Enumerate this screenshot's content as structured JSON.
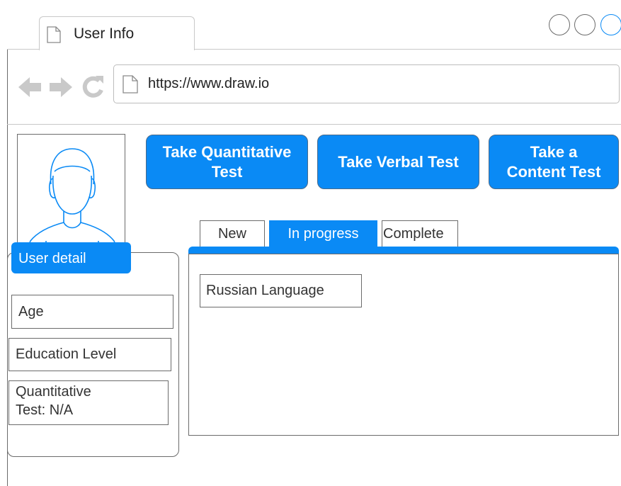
{
  "browser": {
    "tab_title": "User Info",
    "url": "https://www.draw.io",
    "icons": {
      "back": "back-arrow-icon",
      "forward": "forward-arrow-icon",
      "reload": "reload-icon",
      "page": "page-icon"
    }
  },
  "actions": [
    {
      "label": "Take Quantitative\nTest"
    },
    {
      "label": "Take Verbal Test"
    },
    {
      "label": "Take a\nContent Test"
    }
  ],
  "user_detail": {
    "header": "User detail",
    "fields": [
      {
        "value": "Age"
      },
      {
        "value": "Education Level"
      },
      {
        "value": "Quantitative\nTest: N/A"
      }
    ]
  },
  "status_tabs": [
    {
      "label": "New",
      "active": false
    },
    {
      "label": "In progress",
      "active": true
    },
    {
      "label": "Complete",
      "active": false
    }
  ],
  "content": {
    "items": [
      {
        "label": "Russian Language"
      }
    ]
  },
  "colors": {
    "accent": "#0a8af5",
    "border": "#6b6b6b",
    "light_border": "#c8c8c8",
    "icon_gray": "#c9c9c9"
  }
}
